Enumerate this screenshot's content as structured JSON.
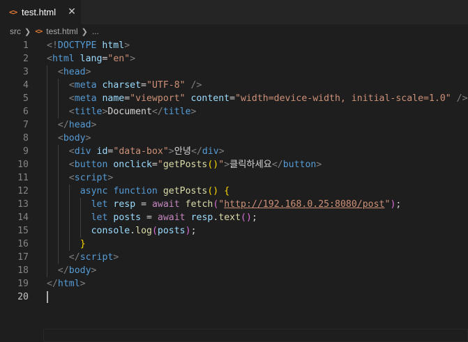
{
  "tab": {
    "filename": "test.html",
    "icon": "html-file-icon",
    "close_label": "✕"
  },
  "breadcrumb": {
    "folder": "src",
    "file": "test.html",
    "more": "..."
  },
  "colors": {
    "bg": "#1e1e1e",
    "tag": "#569cd6",
    "attr": "#9cdcfe",
    "string": "#ce9178",
    "fn": "#dcdcaa",
    "keyword_ctrl": "#c586c0"
  },
  "lines": [
    {
      "n": "1",
      "indent": 0,
      "tokens": [
        [
          "<!",
          "t-br"
        ],
        [
          "DOCTYPE",
          "t-tag"
        ],
        [
          " ",
          "t-txt"
        ],
        [
          "html",
          "t-attr"
        ],
        [
          ">",
          "t-br"
        ]
      ]
    },
    {
      "n": "2",
      "indent": 0,
      "tokens": [
        [
          "<",
          "t-br"
        ],
        [
          "html",
          "t-tag"
        ],
        [
          " ",
          "t-txt"
        ],
        [
          "lang",
          "t-attr"
        ],
        [
          "=",
          "t-txt"
        ],
        [
          "\"en\"",
          "t-str"
        ],
        [
          ">",
          "t-br"
        ]
      ]
    },
    {
      "n": "3",
      "indent": 1,
      "tokens": [
        [
          "<",
          "t-br"
        ],
        [
          "head",
          "t-tag"
        ],
        [
          ">",
          "t-br"
        ]
      ]
    },
    {
      "n": "4",
      "indent": 2,
      "tokens": [
        [
          "<",
          "t-br"
        ],
        [
          "meta",
          "t-tag"
        ],
        [
          " ",
          "t-txt"
        ],
        [
          "charset",
          "t-attr"
        ],
        [
          "=",
          "t-txt"
        ],
        [
          "\"UTF-8\"",
          "t-str"
        ],
        [
          " />",
          "t-br"
        ]
      ]
    },
    {
      "n": "5",
      "indent": 2,
      "tokens": [
        [
          "<",
          "t-br"
        ],
        [
          "meta",
          "t-tag"
        ],
        [
          " ",
          "t-txt"
        ],
        [
          "name",
          "t-attr"
        ],
        [
          "=",
          "t-txt"
        ],
        [
          "\"viewport\"",
          "t-str"
        ],
        [
          " ",
          "t-txt"
        ],
        [
          "content",
          "t-attr"
        ],
        [
          "=",
          "t-txt"
        ],
        [
          "\"width=device-width, initial-scale=1.0\"",
          "t-str"
        ],
        [
          " />",
          "t-br"
        ]
      ]
    },
    {
      "n": "6",
      "indent": 2,
      "tokens": [
        [
          "<",
          "t-br"
        ],
        [
          "title",
          "t-tag"
        ],
        [
          ">",
          "t-br"
        ],
        [
          "Document",
          "t-txt"
        ],
        [
          "</",
          "t-br"
        ],
        [
          "title",
          "t-tag"
        ],
        [
          ">",
          "t-br"
        ]
      ]
    },
    {
      "n": "7",
      "indent": 1,
      "tokens": [
        [
          "</",
          "t-br"
        ],
        [
          "head",
          "t-tag"
        ],
        [
          ">",
          "t-br"
        ]
      ]
    },
    {
      "n": "8",
      "indent": 1,
      "tokens": [
        [
          "<",
          "t-br"
        ],
        [
          "body",
          "t-tag"
        ],
        [
          ">",
          "t-br"
        ]
      ]
    },
    {
      "n": "9",
      "indent": 2,
      "tokens": [
        [
          "<",
          "t-br"
        ],
        [
          "div",
          "t-tag"
        ],
        [
          " ",
          "t-txt"
        ],
        [
          "id",
          "t-attr"
        ],
        [
          "=",
          "t-txt"
        ],
        [
          "\"data-box\"",
          "t-str"
        ],
        [
          ">",
          "t-br"
        ],
        [
          "안녕",
          "t-txt"
        ],
        [
          "</",
          "t-br"
        ],
        [
          "div",
          "t-tag"
        ],
        [
          ">",
          "t-br"
        ]
      ]
    },
    {
      "n": "10",
      "indent": 2,
      "tokens": [
        [
          "<",
          "t-br"
        ],
        [
          "button",
          "t-tag"
        ],
        [
          " ",
          "t-txt"
        ],
        [
          "onclick",
          "t-attr"
        ],
        [
          "=",
          "t-txt"
        ],
        [
          "\"",
          "t-str"
        ],
        [
          "getPosts",
          "t-fn"
        ],
        [
          "()",
          "t-p1"
        ],
        [
          "\"",
          "t-str"
        ],
        [
          ">",
          "t-br"
        ],
        [
          "클릭하세요",
          "t-txt"
        ],
        [
          "</",
          "t-br"
        ],
        [
          "button",
          "t-tag"
        ],
        [
          ">",
          "t-br"
        ]
      ]
    },
    {
      "n": "11",
      "indent": 2,
      "tokens": [
        [
          "<",
          "t-br"
        ],
        [
          "script",
          "t-tag"
        ],
        [
          ">",
          "t-br"
        ]
      ]
    },
    {
      "n": "12",
      "indent": 3,
      "tokens": [
        [
          "async",
          "t-kw"
        ],
        [
          " ",
          "t-txt"
        ],
        [
          "function",
          "t-kw"
        ],
        [
          " ",
          "t-txt"
        ],
        [
          "getPosts",
          "t-fn"
        ],
        [
          "()",
          "t-p1"
        ],
        [
          " ",
          "t-txt"
        ],
        [
          "{",
          "t-p1"
        ]
      ]
    },
    {
      "n": "13",
      "indent": 4,
      "tokens": [
        [
          "let",
          "t-kw"
        ],
        [
          " ",
          "t-txt"
        ],
        [
          "resp",
          "t-var"
        ],
        [
          " = ",
          "t-txt"
        ],
        [
          "await",
          "t-ctrl"
        ],
        [
          " ",
          "t-txt"
        ],
        [
          "fetch",
          "t-fn"
        ],
        [
          "(",
          "t-p2"
        ],
        [
          "\"",
          "t-str"
        ],
        [
          "http://192.168.0.25:8080/post",
          "t-url"
        ],
        [
          "\"",
          "t-str"
        ],
        [
          ")",
          "t-p2"
        ],
        [
          ";",
          "t-txt"
        ]
      ]
    },
    {
      "n": "14",
      "indent": 4,
      "tokens": [
        [
          "let",
          "t-kw"
        ],
        [
          " ",
          "t-txt"
        ],
        [
          "posts",
          "t-var"
        ],
        [
          " = ",
          "t-txt"
        ],
        [
          "await",
          "t-ctrl"
        ],
        [
          " ",
          "t-txt"
        ],
        [
          "resp",
          "t-var"
        ],
        [
          ".",
          "t-txt"
        ],
        [
          "text",
          "t-fn"
        ],
        [
          "()",
          "t-p2"
        ],
        [
          ";",
          "t-txt"
        ]
      ]
    },
    {
      "n": "15",
      "indent": 4,
      "tokens": [
        [
          "console",
          "t-var"
        ],
        [
          ".",
          "t-txt"
        ],
        [
          "log",
          "t-fn"
        ],
        [
          "(",
          "t-p2"
        ],
        [
          "posts",
          "t-var"
        ],
        [
          ")",
          "t-p2"
        ],
        [
          ";",
          "t-txt"
        ]
      ]
    },
    {
      "n": "16",
      "indent": 3,
      "tokens": [
        [
          "}",
          "t-p1"
        ]
      ]
    },
    {
      "n": "17",
      "indent": 2,
      "tokens": [
        [
          "</",
          "t-br"
        ],
        [
          "script",
          "t-tag"
        ],
        [
          ">",
          "t-br"
        ]
      ]
    },
    {
      "n": "18",
      "indent": 1,
      "tokens": [
        [
          "</",
          "t-br"
        ],
        [
          "body",
          "t-tag"
        ],
        [
          ">",
          "t-br"
        ]
      ]
    },
    {
      "n": "19",
      "indent": 0,
      "tokens": [
        [
          "</",
          "t-br"
        ],
        [
          "html",
          "t-tag"
        ],
        [
          ">",
          "t-br"
        ]
      ]
    },
    {
      "n": "20",
      "indent": 0,
      "tokens": []
    }
  ]
}
